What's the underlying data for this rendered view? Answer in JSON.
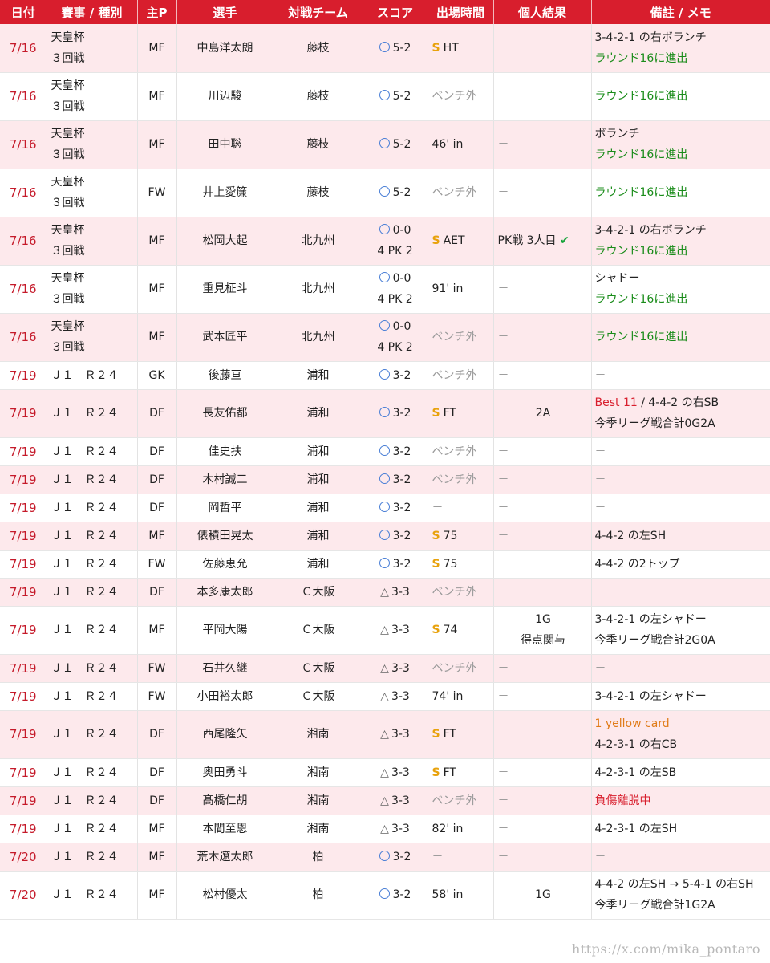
{
  "headers": [
    "日付",
    "賽事 / 種別",
    "主P",
    "選手",
    "対戦チーム",
    "スコア",
    "出場時間",
    "個人結果",
    "備註 / メモ"
  ],
  "rows": [
    {
      "date": "7/16",
      "comp": [
        "天皇杯",
        "３回戦"
      ],
      "pos": "MF",
      "player": "中島洋太朗",
      "opp": "藤枝",
      "result": "win",
      "score": "5-2",
      "pk": "",
      "start": true,
      "time": "HT",
      "time_gray": false,
      "res": [
        "－"
      ],
      "res_center": false,
      "memo": [
        {
          "t": "3-4-2-1 の右ボランチ",
          "c": ""
        },
        {
          "t": "ラウンド16に進出",
          "c": "green"
        }
      ]
    },
    {
      "date": "7/16",
      "comp": [
        "天皇杯",
        "３回戦"
      ],
      "pos": "MF",
      "player": "川辺駿",
      "opp": "藤枝",
      "result": "win",
      "score": "5-2",
      "pk": "",
      "start": false,
      "time": "ベンチ外",
      "time_gray": true,
      "res": [
        "－"
      ],
      "res_center": false,
      "memo": [
        {
          "t": "ラウンド16に進出",
          "c": "green"
        }
      ]
    },
    {
      "date": "7/16",
      "comp": [
        "天皇杯",
        "３回戦"
      ],
      "pos": "MF",
      "player": "田中聡",
      "opp": "藤枝",
      "result": "win",
      "score": "5-2",
      "pk": "",
      "start": false,
      "time": "46' in",
      "time_gray": false,
      "res": [
        "－"
      ],
      "res_center": false,
      "memo": [
        {
          "t": "ボランチ",
          "c": ""
        },
        {
          "t": "ラウンド16に進出",
          "c": "green"
        }
      ]
    },
    {
      "date": "7/16",
      "comp": [
        "天皇杯",
        "３回戦"
      ],
      "pos": "FW",
      "player": "井上愛簾",
      "opp": "藤枝",
      "result": "win",
      "score": "5-2",
      "pk": "",
      "start": false,
      "time": "ベンチ外",
      "time_gray": true,
      "res": [
        "－"
      ],
      "res_center": false,
      "memo": [
        {
          "t": "ラウンド16に進出",
          "c": "green"
        }
      ]
    },
    {
      "date": "7/16",
      "comp": [
        "天皇杯",
        "３回戦"
      ],
      "pos": "MF",
      "player": "松岡大起",
      "opp": "北九州",
      "result": "win",
      "score": "0-0",
      "pk": "4  PK  2",
      "start": true,
      "time": "AET",
      "time_gray": false,
      "res": [
        "PK戦 3人目 ✔"
      ],
      "res_center": false,
      "memo": [
        {
          "t": "3-4-2-1 の右ボランチ",
          "c": ""
        },
        {
          "t": "ラウンド16に進出",
          "c": "green"
        }
      ]
    },
    {
      "date": "7/16",
      "comp": [
        "天皇杯",
        "３回戦"
      ],
      "pos": "MF",
      "player": "重見柾斗",
      "opp": "北九州",
      "result": "win",
      "score": "0-0",
      "pk": "4  PK  2",
      "start": false,
      "time": "91' in",
      "time_gray": false,
      "res": [
        "－"
      ],
      "res_center": false,
      "memo": [
        {
          "t": "シャドー",
          "c": ""
        },
        {
          "t": "ラウンド16に進出",
          "c": "green"
        }
      ]
    },
    {
      "date": "7/16",
      "comp": [
        "天皇杯",
        "３回戦"
      ],
      "pos": "MF",
      "player": "武本匠平",
      "opp": "北九州",
      "result": "win",
      "score": "0-0",
      "pk": "4  PK  2",
      "start": false,
      "time": "ベンチ外",
      "time_gray": true,
      "res": [
        "－"
      ],
      "res_center": false,
      "memo": [
        {
          "t": "ラウンド16に進出",
          "c": "green"
        }
      ]
    },
    {
      "date": "7/19",
      "comp": [
        "Ｊ１　Ｒ２４"
      ],
      "pos": "GK",
      "player": "後藤亘",
      "opp": "浦和",
      "result": "win",
      "score": "3-2",
      "pk": "",
      "start": false,
      "time": "ベンチ外",
      "time_gray": true,
      "res": [
        "－"
      ],
      "res_center": false,
      "memo": [
        {
          "t": "－",
          "c": "gray"
        }
      ]
    },
    {
      "date": "7/19",
      "comp": [
        "Ｊ１　Ｒ２４"
      ],
      "pos": "DF",
      "player": "長友佑都",
      "opp": "浦和",
      "result": "win",
      "score": "3-2",
      "pk": "",
      "start": true,
      "time": "FT",
      "time_gray": false,
      "res": [
        "2A"
      ],
      "res_center": true,
      "memo": [
        {
          "t": "Best 11",
          "c": "red",
          "t2": " / 4-4-2 の右SB"
        },
        {
          "t": "今季リーグ戦合計0G2A",
          "c": ""
        }
      ]
    },
    {
      "date": "7/19",
      "comp": [
        "Ｊ１　Ｒ２４"
      ],
      "pos": "DF",
      "player": "佳史扶",
      "opp": "浦和",
      "result": "win",
      "score": "3-2",
      "pk": "",
      "start": false,
      "time": "ベンチ外",
      "time_gray": true,
      "res": [
        "－"
      ],
      "res_center": false,
      "memo": [
        {
          "t": "－",
          "c": "gray"
        }
      ]
    },
    {
      "date": "7/19",
      "comp": [
        "Ｊ１　Ｒ２４"
      ],
      "pos": "DF",
      "player": "木村誠二",
      "opp": "浦和",
      "result": "win",
      "score": "3-2",
      "pk": "",
      "start": false,
      "time": "ベンチ外",
      "time_gray": true,
      "res": [
        "－"
      ],
      "res_center": false,
      "memo": [
        {
          "t": "－",
          "c": "gray"
        }
      ]
    },
    {
      "date": "7/19",
      "comp": [
        "Ｊ１　Ｒ２４"
      ],
      "pos": "DF",
      "player": "岡哲平",
      "opp": "浦和",
      "result": "win",
      "score": "3-2",
      "pk": "",
      "start": false,
      "time": "－",
      "time_gray": true,
      "res": [
        "－"
      ],
      "res_center": false,
      "memo": [
        {
          "t": "－",
          "c": "gray"
        }
      ]
    },
    {
      "date": "7/19",
      "comp": [
        "Ｊ１　Ｒ２４"
      ],
      "pos": "MF",
      "player": "俵積田晃太",
      "opp": "浦和",
      "result": "win",
      "score": "3-2",
      "pk": "",
      "start": true,
      "time": "75",
      "time_gray": false,
      "res": [
        "－"
      ],
      "res_center": false,
      "memo": [
        {
          "t": "4-4-2 の左SH",
          "c": ""
        }
      ]
    },
    {
      "date": "7/19",
      "comp": [
        "Ｊ１　Ｒ２４"
      ],
      "pos": "FW",
      "player": "佐藤恵允",
      "opp": "浦和",
      "result": "win",
      "score": "3-2",
      "pk": "",
      "start": true,
      "time": "75",
      "time_gray": false,
      "res": [
        "－"
      ],
      "res_center": false,
      "memo": [
        {
          "t": "4-4-2 の2トップ",
          "c": ""
        }
      ]
    },
    {
      "date": "7/19",
      "comp": [
        "Ｊ１　Ｒ２４"
      ],
      "pos": "DF",
      "player": "本多康太郎",
      "opp": "Ｃ大阪",
      "result": "draw",
      "score": "3-3",
      "pk": "",
      "start": false,
      "time": "ベンチ外",
      "time_gray": true,
      "res": [
        "－"
      ],
      "res_center": false,
      "memo": [
        {
          "t": "－",
          "c": "gray"
        }
      ]
    },
    {
      "date": "7/19",
      "comp": [
        "Ｊ１　Ｒ２４"
      ],
      "pos": "MF",
      "player": "平岡大陽",
      "opp": "Ｃ大阪",
      "result": "draw",
      "score": "3-3",
      "pk": "",
      "start": true,
      "time": "74",
      "time_gray": false,
      "res": [
        "1G",
        "得点関与"
      ],
      "res_center": true,
      "memo": [
        {
          "t": "3-4-2-1 の左シャドー",
          "c": ""
        },
        {
          "t": "今季リーグ戦合計2G0A",
          "c": ""
        }
      ]
    },
    {
      "date": "7/19",
      "comp": [
        "Ｊ１　Ｒ２４"
      ],
      "pos": "FW",
      "player": "石井久継",
      "opp": "Ｃ大阪",
      "result": "draw",
      "score": "3-3",
      "pk": "",
      "start": false,
      "time": "ベンチ外",
      "time_gray": true,
      "res": [
        "－"
      ],
      "res_center": false,
      "memo": [
        {
          "t": "－",
          "c": "gray"
        }
      ]
    },
    {
      "date": "7/19",
      "comp": [
        "Ｊ１　Ｒ２４"
      ],
      "pos": "FW",
      "player": "小田裕太郎",
      "opp": "Ｃ大阪",
      "result": "draw",
      "score": "3-3",
      "pk": "",
      "start": false,
      "time": "74' in",
      "time_gray": false,
      "res": [
        "－"
      ],
      "res_center": false,
      "memo": [
        {
          "t": "3-4-2-1 の左シャドー",
          "c": ""
        }
      ]
    },
    {
      "date": "7/19",
      "comp": [
        "Ｊ１　Ｒ２４"
      ],
      "pos": "DF",
      "player": "西尾隆矢",
      "opp": "湘南",
      "result": "draw",
      "score": "3-3",
      "pk": "",
      "start": true,
      "time": "FT",
      "time_gray": false,
      "res": [
        "－"
      ],
      "res_center": false,
      "memo": [
        {
          "t": "1 yellow card",
          "c": "orange"
        },
        {
          "t": "4-2-3-1 の右CB",
          "c": ""
        }
      ]
    },
    {
      "date": "7/19",
      "comp": [
        "Ｊ１　Ｒ２４"
      ],
      "pos": "DF",
      "player": "奥田勇斗",
      "opp": "湘南",
      "result": "draw",
      "score": "3-3",
      "pk": "",
      "start": true,
      "time": "FT",
      "time_gray": false,
      "res": [
        "－"
      ],
      "res_center": false,
      "memo": [
        {
          "t": "4-2-3-1 の左SB",
          "c": ""
        }
      ]
    },
    {
      "date": "7/19",
      "comp": [
        "Ｊ１　Ｒ２４"
      ],
      "pos": "DF",
      "player": "髙橋仁胡",
      "opp": "湘南",
      "result": "draw",
      "score": "3-3",
      "pk": "",
      "start": false,
      "time": "ベンチ外",
      "time_gray": true,
      "res": [
        "－"
      ],
      "res_center": false,
      "memo": [
        {
          "t": "負傷離脱中",
          "c": "red"
        }
      ]
    },
    {
      "date": "7/19",
      "comp": [
        "Ｊ１　Ｒ２４"
      ],
      "pos": "MF",
      "player": "本間至恩",
      "opp": "湘南",
      "result": "draw",
      "score": "3-3",
      "pk": "",
      "start": false,
      "time": "82' in",
      "time_gray": false,
      "res": [
        "－"
      ],
      "res_center": false,
      "memo": [
        {
          "t": "4-2-3-1 の左SH",
          "c": ""
        }
      ]
    },
    {
      "date": "7/20",
      "comp": [
        "Ｊ１　Ｒ２４"
      ],
      "pos": "MF",
      "player": "荒木遼太郎",
      "opp": "柏",
      "result": "win",
      "score": "3-2",
      "pk": "",
      "start": false,
      "time": "－",
      "time_gray": true,
      "res": [
        "－"
      ],
      "res_center": false,
      "memo": [
        {
          "t": "－",
          "c": "gray"
        }
      ]
    },
    {
      "date": "7/20",
      "comp": [
        "Ｊ１　Ｒ２４"
      ],
      "pos": "MF",
      "player": "松村優太",
      "opp": "柏",
      "result": "win",
      "score": "3-2",
      "pk": "",
      "start": false,
      "time": "58' in",
      "time_gray": false,
      "res": [
        "1G"
      ],
      "res_center": true,
      "memo": [
        {
          "t": "4-4-2 の左SH → 5-4-1 の右SH",
          "c": ""
        },
        {
          "t": "今季リーグ戦合計1G2A",
          "c": ""
        }
      ]
    }
  ],
  "row_heights": [],
  "watermark": "https://x.com/mika_pontaro",
  "colors": {
    "header_bg": "#d81e2d",
    "row_alt": "#fde9ec",
    "date": "#c51a2a",
    "green": "#1a8c1a",
    "red": "#d81e2d",
    "orange": "#e07b17",
    "start_badge": "#e8a20c",
    "win_circle": "#4a7fd6"
  }
}
